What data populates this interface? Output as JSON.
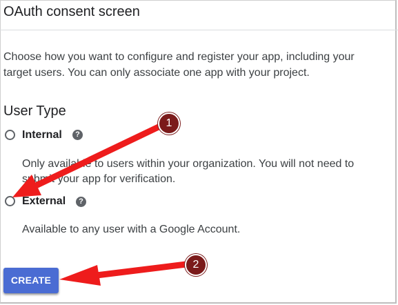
{
  "header": {
    "title": "OAuth consent screen"
  },
  "intro": {
    "text": "Choose how you want to configure and register your app, including your target users. You can only associate one app with your project."
  },
  "user_type": {
    "heading": "User Type",
    "options": [
      {
        "label": "Internal",
        "description": "Only available to users within your organization. You will not need to submit your app for verification.",
        "selected": false
      },
      {
        "label": "External",
        "description": "Available to any user with a Google Account.",
        "selected": false
      }
    ]
  },
  "actions": {
    "create_label": "CREATE"
  },
  "annotations": {
    "badge1": "1",
    "badge2": "2",
    "arrow_color": "#ee1c1c",
    "badge_color": "#7b1a1a"
  },
  "icons": {
    "help": "?"
  }
}
